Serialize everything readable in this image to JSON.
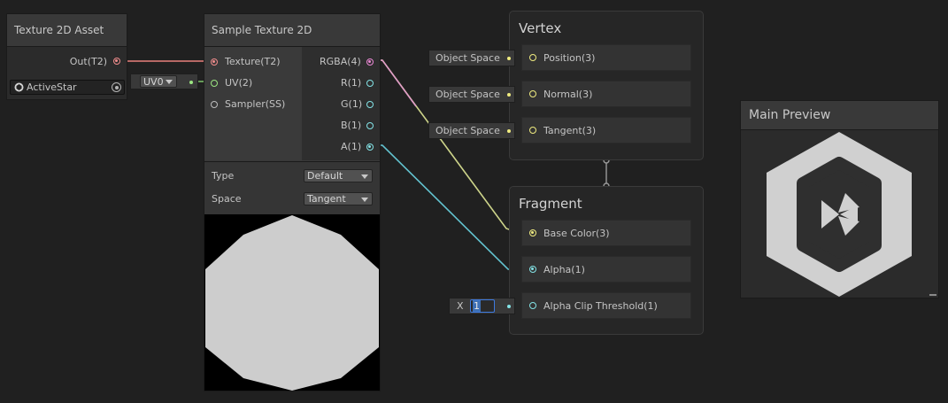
{
  "texture_asset_node": {
    "title": "Texture 2D Asset",
    "output_label": "Out(T2)",
    "asset_name": "ActiveStar",
    "asset_icon": "unity-asset-icon",
    "picker_icon": "object-picker-icon"
  },
  "uv_inline": {
    "value": "UV0"
  },
  "sample_node": {
    "title": "Sample Texture 2D",
    "inputs": [
      "Texture(T2)",
      "UV(2)",
      "Sampler(SS)"
    ],
    "outputs": [
      "RGBA(4)",
      "R(1)",
      "G(1)",
      "B(1)",
      "A(1)"
    ],
    "type_label": "Type",
    "type_value": "Default",
    "space_label": "Space",
    "space_value": "Tangent"
  },
  "vertex_context": {
    "title": "Vertex",
    "blocks": [
      "Position(3)",
      "Normal(3)",
      "Tangent(3)"
    ],
    "space_tags": [
      "Object Space",
      "Object Space",
      "Object Space"
    ]
  },
  "fragment_context": {
    "title": "Fragment",
    "blocks": [
      "Base Color(3)",
      "Alpha(1)",
      "Alpha Clip Threshold(1)"
    ],
    "threshold_axis": "X",
    "threshold_value": "1"
  },
  "main_preview": {
    "title": "Main Preview"
  },
  "colors": {
    "texture_port": "#f08c8c",
    "rgba_port": "#ea88d4",
    "vector2_port": "#9ce682",
    "vector3_port": "#f0ec80",
    "float_port": "#84e4e7",
    "wire_texture": "#e8807c",
    "wire_rgba_to_base": "#cdd48a",
    "wire_alpha": "#63c3d0"
  }
}
